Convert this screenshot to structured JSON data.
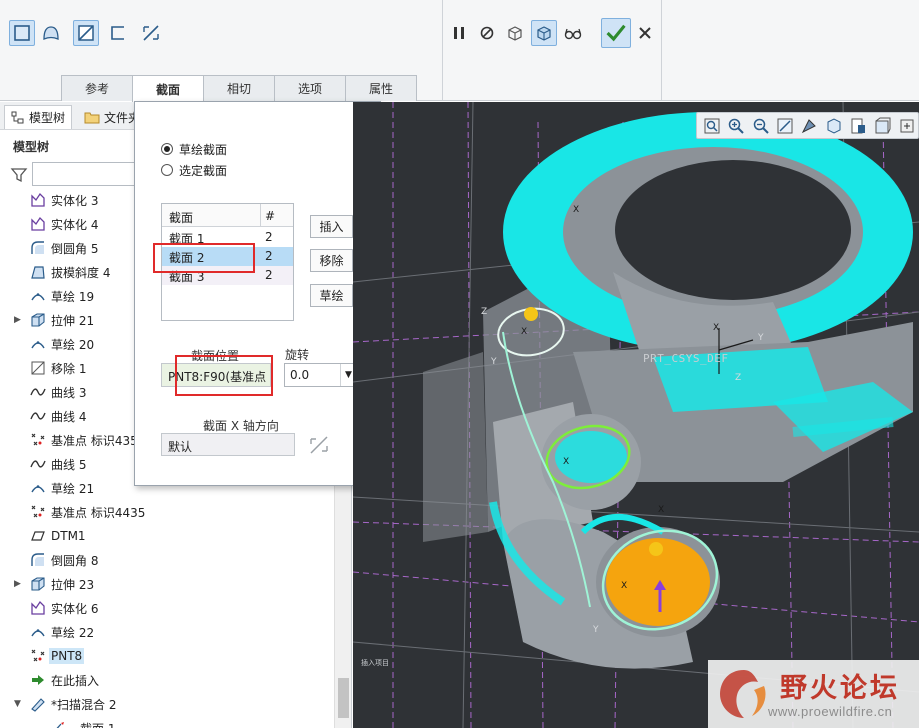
{
  "ribbon": {
    "tabs": [
      {
        "label": "参考",
        "active": false
      },
      {
        "label": "截面",
        "active": true
      },
      {
        "label": "相切",
        "active": false
      },
      {
        "label": "选项",
        "active": false
      },
      {
        "label": "属性",
        "active": false
      }
    ],
    "tools_left": [
      "solid-icon",
      "surface-icon",
      "remove-material-icon",
      "thicken-icon",
      "exchange-icon"
    ],
    "tools_right": [
      "pause-icon",
      "no-preview-icon",
      "check-geometry-icon",
      "verify-icon",
      "glasses-icon",
      "ok-check-icon",
      "cancel-x-icon"
    ]
  },
  "left_panel": {
    "tabs": {
      "model_tree": "模型树",
      "folder": "文件夹"
    },
    "title": "模型树",
    "filter_placeholder": "",
    "items": [
      {
        "label": "实体化 3",
        "icon": "solidify-icon",
        "expand": false
      },
      {
        "label": "实体化 4",
        "icon": "solidify-icon",
        "expand": false
      },
      {
        "label": "倒圆角 5",
        "icon": "round-icon",
        "expand": false
      },
      {
        "label": "拔模斜度 4",
        "icon": "draft-icon",
        "expand": false
      },
      {
        "label": "草绘 19",
        "icon": "sketch-icon",
        "expand": false
      },
      {
        "label": "拉伸 21",
        "icon": "extrude-icon",
        "expand": true
      },
      {
        "label": "草绘 20",
        "icon": "sketch-icon",
        "expand": false
      },
      {
        "label": "移除 1",
        "icon": "remove-icon",
        "expand": false
      },
      {
        "label": "曲线 3",
        "icon": "curve-icon",
        "expand": false
      },
      {
        "label": "曲线 4",
        "icon": "curve-icon",
        "expand": false
      },
      {
        "label": "基准点 标识435",
        "icon": "datum-point-icon",
        "expand": false
      },
      {
        "label": "曲线 5",
        "icon": "curve-icon",
        "expand": false
      },
      {
        "label": "草绘 21",
        "icon": "sketch-icon",
        "expand": false
      },
      {
        "label": "基准点 标识4435",
        "icon": "datum-point-icon",
        "expand": false
      },
      {
        "label": "DTM1",
        "icon": "datum-plane-icon",
        "expand": false
      },
      {
        "label": "倒圆角 8",
        "icon": "round-icon",
        "expand": false
      },
      {
        "label": "拉伸 23",
        "icon": "extrude-icon",
        "expand": true
      },
      {
        "label": "实体化 6",
        "icon": "solidify-icon",
        "expand": false
      },
      {
        "label": "草绘 22",
        "icon": "sketch-icon",
        "expand": false
      },
      {
        "label": "PNT8",
        "icon": "datum-point-icon",
        "expand": false,
        "selected": true
      },
      {
        "label": "在此插入",
        "icon": "insert-here-icon",
        "expand": false
      },
      {
        "label": "*扫描混合 2",
        "icon": "sweep-blend-icon",
        "expand": true
      },
      {
        "label": "截面 1",
        "icon": "section-icon",
        "expand": false,
        "child": true
      }
    ]
  },
  "dialog": {
    "radio_sketched": "草绘截面",
    "radio_selected": "选定截面",
    "table_headers": {
      "name": "截面",
      "count": "#"
    },
    "sections": [
      {
        "name": "截面 1",
        "count": "2"
      },
      {
        "name": "截面 2",
        "count": "2",
        "selected": true
      },
      {
        "name": "截面 3",
        "count": "2"
      }
    ],
    "buttons": {
      "insert": "插入",
      "remove": "移除",
      "sketch": "草绘"
    },
    "location_label": "截面位置",
    "location_value": "PNT8:F90(基准点",
    "rotation_label": "旋转",
    "rotation_value": "0.0",
    "xdir_label": "截面 X 轴方向",
    "xdir_value": "默认"
  },
  "viewport": {
    "csys_label": "PRT_CSYS_DEF",
    "axis_labels": {
      "x": "X",
      "y": "Y",
      "z": "Z"
    },
    "view_tools": [
      "refit-icon",
      "zoom-in-icon",
      "zoom-out-icon",
      "repaint-icon",
      "display-style-icon",
      "saved-views-icon",
      "view-manager-icon",
      "perspective-icon",
      "datum-display-icon"
    ],
    "colors": {
      "background": "#2f3236",
      "cyan": "#19e6e6",
      "gray": "#8c9298",
      "orange": "#f5a40e"
    }
  },
  "watermark": {
    "text": "野火论坛",
    "url": "www.proewildfire.cn"
  }
}
